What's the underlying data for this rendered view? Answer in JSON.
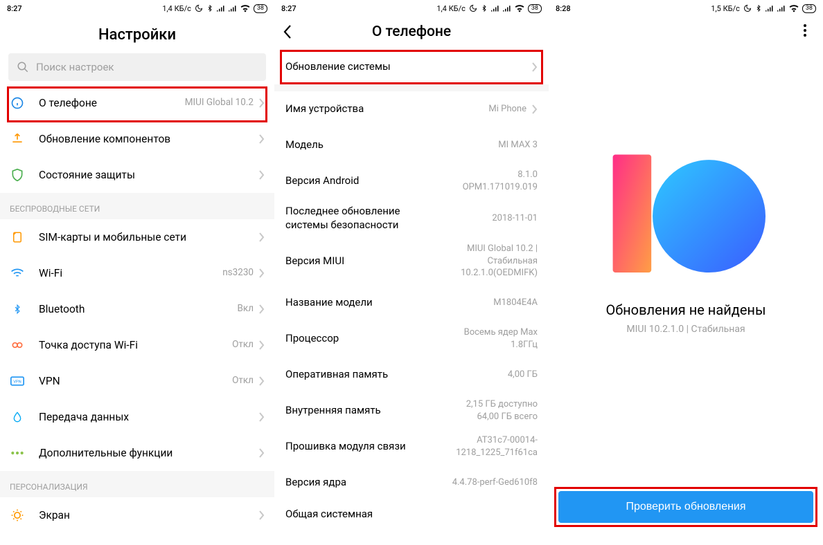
{
  "statusbar": {
    "time_a": "8:27",
    "time_b": "8:27",
    "time_c": "8:28",
    "speed_a": "1,4 КБ/с",
    "speed_b": "1,4 КБ/с",
    "speed_c": "1,5 КБ/с",
    "battery": "38"
  },
  "screen1": {
    "title": "Настройки",
    "search_placeholder": "Поиск настроек",
    "about_label": "О телефоне",
    "about_value": "MIUI Global 10.2",
    "components_label": "Обновление компонентов",
    "security_label": "Состояние защиты",
    "section_wireless": "БЕСПРОВОДНЫЕ СЕТИ",
    "sim_label": "SIM-карты и мобильные сети",
    "wifi_label": "Wi-Fi",
    "wifi_value": "ns3230",
    "bt_label": "Bluetooth",
    "bt_value": "Вкл",
    "hotspot_label": "Точка доступа Wi-Fi",
    "hotspot_value": "Откл",
    "vpn_label": "VPN",
    "vpn_value": "Откл",
    "data_label": "Передача данных",
    "more_label": "Дополнительные функции",
    "section_personal": "ПЕРСОНАЛИЗАЦИЯ",
    "display_label": "Экран"
  },
  "screen2": {
    "title": "О телефоне",
    "system_update": "Обновление системы",
    "device_name_k": "Имя устройства",
    "device_name_v": "Mi Phone",
    "model_k": "Модель",
    "model_v": "MI MAX 3",
    "android_k": "Версия Android",
    "android_v": "8.1.0\nOPM1.171019.019",
    "secpatch_k": "Последнее обновление системы безопасности",
    "secpatch_v": "2018-11-01",
    "miui_k": "Версия MIUI",
    "miui_v": "MIUI Global 10.2 |\nСтабильная\n10.2.1.0(OEDMIFK)",
    "modelname_k": "Название модели",
    "modelname_v": "M1804E4A",
    "cpu_k": "Процессор",
    "cpu_v": "Восемь ядер Max\n1.8ГГц",
    "ram_k": "Оперативная память",
    "ram_v": "4,00 ГБ",
    "storage_k": "Внутренняя память",
    "storage_v": "2,15 ГБ доступно\n64,00 ГБ всего",
    "baseband_k": "Прошивка модуля связи",
    "baseband_v": "AT31c7-00014-\n1218_1225_71f61ca",
    "kernel_k": "Версия ядра",
    "kernel_v": "4.4.78-perf-Ged610f8",
    "general_k": "Общая системная"
  },
  "screen3": {
    "no_updates": "Обновления не найдены",
    "version": "MIUI 10.2.1.0 | Стабильная",
    "check_btn": "Проверить обновления"
  }
}
